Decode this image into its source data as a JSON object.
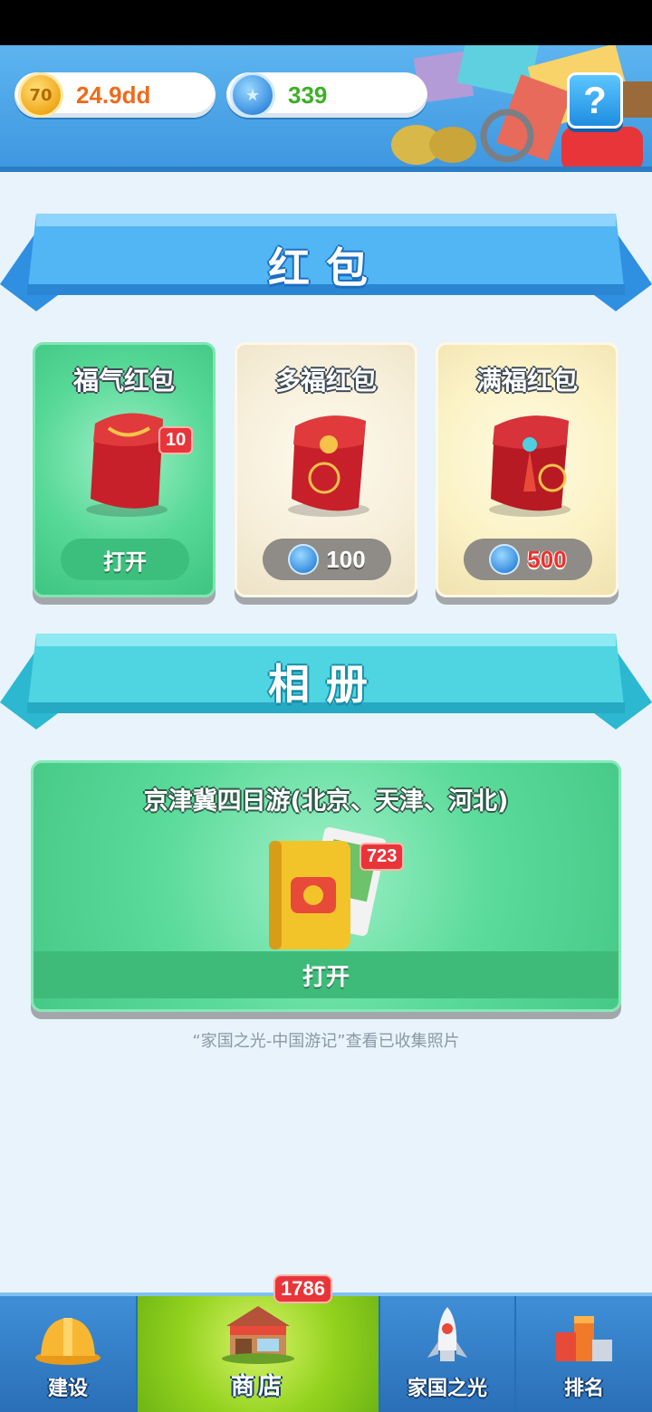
{
  "header": {
    "coin_value": "24.9dd",
    "coin_icon_text": "70",
    "gem_value": "339",
    "help_label": "?"
  },
  "red_packet": {
    "section_title": "红包",
    "cards": [
      {
        "title": "福气红包",
        "badge": "10",
        "button_label": "打开"
      },
      {
        "title": "多福红包",
        "cost": "100"
      },
      {
        "title": "满福红包",
        "cost": "500"
      }
    ]
  },
  "album": {
    "section_title": "相册",
    "card_title": "京津冀四日游(北京、天津、河北)",
    "badge": "723",
    "button_label": "打开",
    "hint": "“家国之光-中国游记”查看已收集照片"
  },
  "nav": {
    "shop_badge": "1786",
    "items": [
      {
        "label": "建设"
      },
      {
        "label": "商店"
      },
      {
        "label": "家国之光"
      },
      {
        "label": "排名"
      }
    ]
  },
  "colors": {
    "header_blue": "#3f98e0",
    "card_green": "#56d896",
    "badge_red": "#e8353a",
    "shop_green": "#93d21e"
  }
}
